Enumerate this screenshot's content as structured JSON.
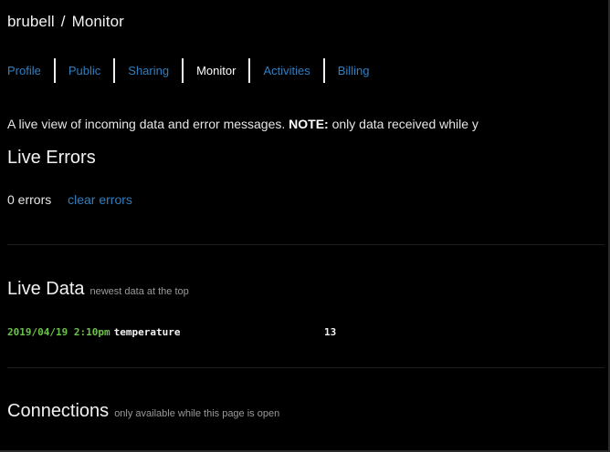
{
  "breadcrumb": {
    "user": "brubell",
    "separator": "/",
    "page": "Monitor"
  },
  "tabs": [
    {
      "label": "Profile",
      "active": false
    },
    {
      "label": "Public",
      "active": false
    },
    {
      "label": "Sharing",
      "active": false
    },
    {
      "label": "Monitor",
      "active": true
    },
    {
      "label": "Activities",
      "active": false
    },
    {
      "label": "Billing",
      "active": false
    }
  ],
  "intro": {
    "text": "A live view of incoming data and error messages.",
    "note_label": "NOTE:",
    "note_text": "only data received while y"
  },
  "live_errors": {
    "title": "Live Errors",
    "count_text": "0 errors",
    "clear_label": "clear errors"
  },
  "live_data": {
    "title": "Live Data",
    "subtitle": "newest data at the top",
    "rows": [
      {
        "timestamp": "2019/04/19 2:10pm",
        "key": "temperature",
        "value": "13"
      }
    ]
  },
  "connections": {
    "title": "Connections",
    "subtitle": "only available while this page is open"
  },
  "colors": {
    "background": "#000000",
    "link": "#2f7fc1",
    "timestamp": "#6cc24a",
    "text": "#e6e6e6"
  }
}
